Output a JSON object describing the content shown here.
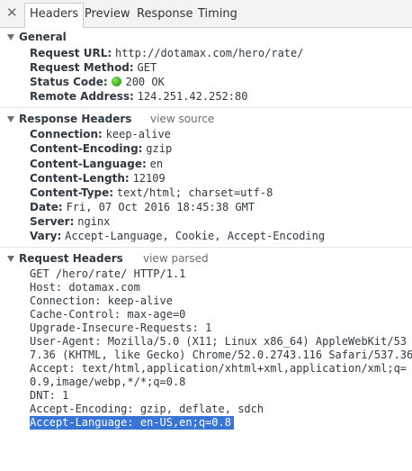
{
  "tabs": [
    "Headers",
    "Preview",
    "Response",
    "Timing"
  ],
  "general": {
    "title": "General",
    "rows": [
      {
        "key": "Request URL:",
        "value": "http://dotamax.com/hero/rate/"
      },
      {
        "key": "Request Method:",
        "value": "GET"
      },
      {
        "key": "Status Code:",
        "value": "200 OK"
      },
      {
        "key": "Remote Address:",
        "value": "124.251.42.252:80"
      }
    ]
  },
  "response_headers": {
    "title": "Response Headers",
    "link": "view source",
    "rows": [
      {
        "key": "Connection:",
        "value": "keep-alive"
      },
      {
        "key": "Content-Encoding:",
        "value": "gzip"
      },
      {
        "key": "Content-Language:",
        "value": "en"
      },
      {
        "key": "Content-Length:",
        "value": "12109"
      },
      {
        "key": "Content-Type:",
        "value": "text/html; charset=utf-8"
      },
      {
        "key": "Date:",
        "value": "Fri, 07 Oct 2016 18:45:38 GMT"
      },
      {
        "key": "Server:",
        "value": "nginx"
      },
      {
        "key": "Vary:",
        "value": "Accept-Language, Cookie, Accept-Encoding"
      }
    ]
  },
  "request_headers": {
    "title": "Request Headers",
    "link": "view parsed",
    "lines": [
      "GET /hero/rate/ HTTP/1.1",
      "Host: dotamax.com",
      "Connection: keep-alive",
      "Cache-Control: max-age=0",
      "Upgrade-Insecure-Requests: 1",
      "User-Agent: Mozilla/5.0 (X11; Linux x86_64) AppleWebKit/53",
      "7.36 (KHTML, like Gecko) Chrome/52.0.2743.116 Safari/537.36",
      "Accept: text/html,application/xhtml+xml,application/xml;q=",
      "0.9,image/webp,*/*;q=0.8",
      "DNT: 1",
      "Accept-Encoding: gzip, deflate, sdch",
      "Accept-Language: en-US,en;q=0.8"
    ]
  },
  "status_color": "#3bb61e",
  "selection_color": "#3875d7"
}
